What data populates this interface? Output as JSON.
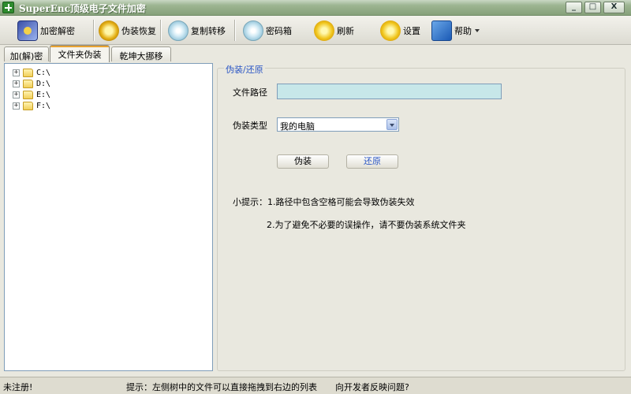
{
  "window": {
    "title": "SuperEnc顶级电子文件加密",
    "min": "_",
    "max": "□",
    "close": "X"
  },
  "toolbar": {
    "items": [
      {
        "label": "加密解密",
        "icon": "film-icon"
      },
      {
        "label": "伪装恢复",
        "icon": "gear-icon"
      },
      {
        "label": "复制转移",
        "icon": "disc-icon"
      },
      {
        "label": "密码箱",
        "icon": "disc-icon"
      },
      {
        "label": "刷新",
        "icon": "sun-icon"
      },
      {
        "label": "设置",
        "icon": "sun-icon"
      },
      {
        "label": "帮助",
        "icon": "cube-icon"
      }
    ]
  },
  "tabs": [
    {
      "label": "加(解)密"
    },
    {
      "label": "文件夹伪装",
      "active": true
    },
    {
      "label": "乾坤大挪移"
    }
  ],
  "tree": {
    "drives": [
      {
        "label": "C:\\",
        "expander": "+"
      },
      {
        "label": "D:\\",
        "expander": "+"
      },
      {
        "label": "E:\\",
        "expander": "+"
      },
      {
        "label": "F:\\",
        "expander": "+"
      }
    ]
  },
  "panel": {
    "group_title": "伪装/还原",
    "path_label": "文件路径",
    "path_value": "",
    "type_label": "伪装类型",
    "type_value": "我的电脑",
    "disguise_button": "伪装",
    "restore_button": "还原",
    "tip1": "小提示：1.路径中包含空格可能会导致伪装失效",
    "tip2": "2.为了避免不必要的误操作，请不要伪装系统文件夹"
  },
  "statusbar": {
    "registration": "未注册!",
    "hint": "提示：左侧树中的文件可以直接拖拽到右边的列表",
    "feedback": "向开发者反映问题?"
  },
  "colors": {
    "accent_link": "#2a55c4",
    "input_bg": "#c7e7e9",
    "titlebar": "#86a17a"
  }
}
